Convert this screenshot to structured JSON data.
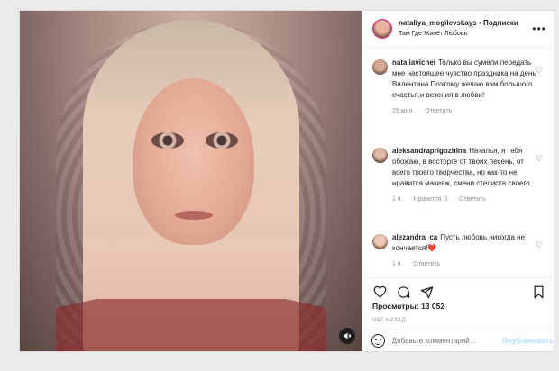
{
  "header": {
    "username": "nataliya_mogilevskays",
    "dot": "•",
    "follow": "Подписки",
    "location": "Там Где Живёт Любовь",
    "more_icon": "more-horizontal-icon"
  },
  "comments": [
    {
      "user": "nataliavicnei",
      "text": "Только вы сумели передать мне настоящее чувство праздника на день Валентина.Поэтому желаю вам большого счастья,и везения в любви!",
      "time": "29 мин.",
      "likes": "",
      "reply": "Ответить"
    },
    {
      "user": "aleksandraprigozhina",
      "text": "Наталья, я тебя обожаю, в восторге от твоих песень, от всего твоего творчества, но как-то не нравится макияж, смени стелиста своего",
      "time": "1 ч.",
      "likes": "Нравится: 1",
      "reply": "Ответить"
    },
    {
      "user": "alezandra_ca",
      "text": "Пусть любовь никогда не кончается!❤️",
      "time": "1 ч.",
      "likes": "",
      "reply": "Ответить"
    }
  ],
  "stats": {
    "views": "Просмотры: 13 052",
    "time_ago": "ЧАС НАЗАД"
  },
  "add_comment": {
    "placeholder": "Добавьте комментарий...",
    "publish": "Опубликовать"
  },
  "icons": {
    "like": "heart-icon",
    "comment": "comment-icon",
    "share": "paper-plane-icon",
    "save": "bookmark-icon",
    "mute": "speaker-muted-icon",
    "emoji": "emoji-icon"
  },
  "colors": {
    "link_disabled": "#b3dbff",
    "muted_text": "#8e8e8e",
    "story_ring": "#d6249f"
  }
}
